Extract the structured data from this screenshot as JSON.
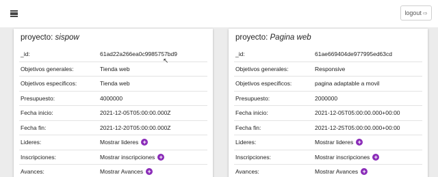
{
  "header": {
    "logout_label": "logout",
    "logout_icon": "⇨"
  },
  "projects": [
    {
      "title_prefix": "proyecto:",
      "name": "sispow",
      "rows": [
        {
          "key": "_id:",
          "value": "61ad22a266ea0c9985757bd9"
        },
        {
          "key": "Objetivos generales:",
          "value": "Tienda web"
        },
        {
          "key": "Objetivos especificos:",
          "value": "Tienda web"
        },
        {
          "key": "Presupuesto:",
          "value": "4000000"
        },
        {
          "key": "Fecha inicio:",
          "value": "2021-12-05T05:00:00.000Z"
        },
        {
          "key": "Fecha fin:",
          "value": "2021-12-20T05:00:00.000Z"
        },
        {
          "key": "Lideres:",
          "value": "Mostrar lideres"
        },
        {
          "key": "Inscripciones:",
          "value": "Mostrar inscripciones"
        },
        {
          "key": "Avances:",
          "value": "Mostrar Avances"
        }
      ]
    },
    {
      "title_prefix": "proyecto:",
      "name": "Pagina web",
      "rows": [
        {
          "key": "_id:",
          "value": "61ae669404de977995ed63cd"
        },
        {
          "key": "Objetivos generales:",
          "value": "Responsive"
        },
        {
          "key": "Objetivos especificos:",
          "value": "pagina adaptable a movil"
        },
        {
          "key": "Presupuesto:",
          "value": "2000000"
        },
        {
          "key": "Fecha inicio:",
          "value": "2021-12-05T05:00:00.000+00:00"
        },
        {
          "key": "Fecha fin:",
          "value": "2021-12-25T05:00:00.000+00:00"
        },
        {
          "key": "Lideres:",
          "value": "Mostrar lideres"
        },
        {
          "key": "Inscripciones:",
          "value": "Mostrar inscripciones"
        },
        {
          "key": "Avances:",
          "value": "Mostrar Avances"
        }
      ]
    }
  ],
  "plus_symbol": "+",
  "colors": {
    "accent": "#8a2bb8"
  }
}
